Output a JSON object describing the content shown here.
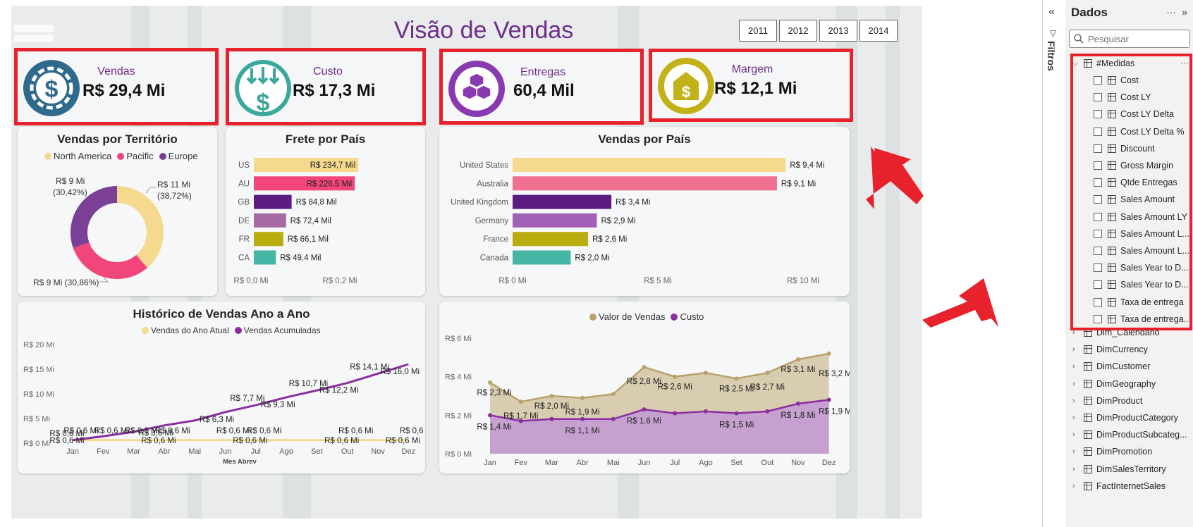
{
  "report": {
    "title": "Visão de Vendas",
    "year_buttons": [
      "2011",
      "2012",
      "2013",
      "2014"
    ]
  },
  "kpis": [
    {
      "label": "Vendas",
      "value": "R$ 29,4 Mi",
      "icon": "dollar-gear-icon",
      "color": "#2e6a8e"
    },
    {
      "label": "Custo",
      "value": "R$ 17,3 Mi",
      "icon": "dollar-arrows-icon",
      "color": "#3aa89b"
    },
    {
      "label": "Entregas",
      "value": "60,4 Mil",
      "icon": "boxes-icon",
      "color": "#8a3ab0"
    },
    {
      "label": "Margem",
      "value": "R$ 12,1 Mi",
      "icon": "dollar-house-icon",
      "color": "#c2b117"
    }
  ],
  "colors": {
    "accent": "#6d2e8c",
    "highlight": "#e8222c"
  },
  "chart_data": [
    {
      "type": "pie",
      "title": "Vendas por Território",
      "categories": [
        "North America",
        "Pacific",
        "Europe"
      ],
      "values": [
        38.72,
        30.86,
        30.42
      ],
      "colors": [
        "#f5d98e",
        "#f0467a",
        "#7b3f98"
      ],
      "data_labels": [
        "R$ 11 Mi",
        "(38,72%)",
        "R$ 9 Mi (30,86%)",
        "R$ 9 Mi",
        "(30,42%)"
      ],
      "legend": "top"
    },
    {
      "type": "bar",
      "orientation": "horizontal",
      "title": "Frete por País",
      "categories": [
        "US",
        "AU",
        "GB",
        "DE",
        "FR",
        "CA"
      ],
      "values": [
        234.7,
        226.5,
        84.8,
        72.4,
        66.1,
        49.4
      ],
      "data_labels": [
        "R$ 234,7 Mil",
        "R$ 226,5 Mil",
        "R$ 84,8 Mil",
        "R$ 72,4 Mil",
        "R$ 66,1 Mil",
        "R$ 49,4 Mil"
      ],
      "colors": [
        "#f5d98e",
        "#f0467a",
        "#5c1b80",
        "#a56aa3",
        "#b9ad0f",
        "#45b5a5"
      ],
      "xlim": [
        0,
        250
      ],
      "xticks": [
        "R$ 0,0 Mi",
        "R$ 0,2 Mi"
      ]
    },
    {
      "type": "bar",
      "orientation": "horizontal",
      "title": "Vendas por País",
      "categories": [
        "United States",
        "Australia",
        "United Kingdom",
        "Germany",
        "France",
        "Canada"
      ],
      "values": [
        9.4,
        9.1,
        3.4,
        2.9,
        2.6,
        2.0
      ],
      "data_labels": [
        "R$ 9,4 Mi",
        "R$ 9,1 Mi",
        "R$ 3,4 Mi",
        "R$ 2,9 Mi",
        "R$ 2,6 Mi",
        "R$ 2,0 Mi"
      ],
      "colors": [
        "#f5d98e",
        "#f0708f",
        "#5c1b80",
        "#a260b8",
        "#b9ad0f",
        "#45b5a5"
      ],
      "xlim": [
        0,
        10
      ],
      "xticks": [
        "R$ 0 Mi",
        "R$ 5 Mi",
        "R$ 10 Mi"
      ]
    },
    {
      "type": "line",
      "title": "Histórico de Vendas Ano a Ano",
      "xlabel": "Mes Abrev",
      "categories": [
        "Jan",
        "Fev",
        "Mar",
        "Abr",
        "Mai",
        "Jun",
        "Jul",
        "Ago",
        "Set",
        "Out",
        "Nov",
        "Dez"
      ],
      "series": [
        {
          "name": "Vendas do Ano Atual",
          "color": "#f5d98e",
          "values": [
            0.6,
            0.6,
            0.6,
            0.6,
            0.6,
            0.6,
            0.6,
            0.6,
            0.6,
            0.6,
            0.6,
            0.6
          ]
        },
        {
          "name": "Vendas Acumuladas",
          "color": "#8a2ea0",
          "values": [
            0.6,
            1.4,
            2.3,
            3.6,
            4.6,
            6.3,
            7.7,
            9.3,
            10.7,
            12.2,
            14.1,
            16.0
          ]
        }
      ],
      "labels_cum": [
        "R$ 0,6 Mi",
        "",
        "",
        "R$ 3,6 Mi",
        "",
        "R$ 6,3 Mi",
        "R$ 7,7 Mi",
        "R$ 9,3 Mi",
        "R$ 10,7 Mi",
        "R$ 12,2 Mi",
        "R$ 14,1 Mi",
        "R$ 16,0 Mi"
      ],
      "labels_cur": [
        "R$ 0,6 Mi",
        "R$ 0,6 Mi",
        "R$ 0,6 Mi",
        "R$ 0,6 Mi",
        "",
        "R$ 0,6 Mi",
        "R$ 0,6 Mi",
        "",
        "",
        "R$ 0,6 Mi",
        "",
        "R$ 0,6 Mi"
      ],
      "labels_cur2": [
        "R$ 0,6 Mi",
        "",
        "",
        "R$ 0,6 Mi",
        "",
        "",
        "R$ 0,6 Mi",
        "",
        "",
        "R$ 0,6 Mi",
        "",
        "R$ 0,6 Mi"
      ],
      "ylim": [
        0,
        20
      ],
      "yticks": [
        "R$ 0 Mi",
        "R$ 5 Mi",
        "R$ 10 Mi",
        "R$ 15 Mi",
        "R$ 20 Mi"
      ],
      "legend": "top"
    },
    {
      "type": "area",
      "categories": [
        "Jan",
        "Fev",
        "Mar",
        "Abr",
        "Mai",
        "Jun",
        "Jul",
        "Ago",
        "Set",
        "Out",
        "Nov",
        "Dez"
      ],
      "series": [
        {
          "name": "Valor de Vendas",
          "color": "#b9a26a",
          "values": [
            3.7,
            2.7,
            3.0,
            2.9,
            3.1,
            4.5,
            4.0,
            4.2,
            3.9,
            4.2,
            4.9,
            5.2
          ]
        },
        {
          "name": "Custo",
          "color": "#8a2ea0",
          "values": [
            2.0,
            1.7,
            1.8,
            1.8,
            1.8,
            2.3,
            2.1,
            2.2,
            2.1,
            2.2,
            2.6,
            2.8
          ]
        }
      ],
      "labels_sales": [
        "R$ 2,3 Mi",
        "R$ 1,7 Mi",
        "R$ 2,0 Mi",
        "R$ 1,9 Mi",
        "",
        "R$ 2,8 Mi",
        "R$ 2,6 Mi",
        "",
        "R$ 2,5 Mi",
        "R$ 2,7 Mi",
        "R$ 3,1 Mi",
        "R$ 3,2 Mi"
      ],
      "labels_cost": [
        "R$ 1,4 Mi",
        "",
        "",
        "R$ 1,1 Mi",
        "",
        "R$ 1,6 Mi",
        "",
        "",
        "R$ 1,5 Mi",
        "",
        "R$ 1,8 Mi",
        "R$ 1,9 Mi"
      ],
      "ylim": [
        0,
        6
      ],
      "yticks": [
        "R$ 0 Mi",
        "R$ 2 Mi",
        "R$ 4 Mi",
        "R$ 6 Mi"
      ],
      "legend": "top"
    }
  ],
  "filters": {
    "label": "Filtros"
  },
  "data_pane": {
    "title": "Dados",
    "search_placeholder": "Pesquisar",
    "measures_table": "#Medidas",
    "measures": [
      "Cost",
      "Cost LY",
      "Cost LY Delta",
      "Cost LY Delta %",
      "Discount",
      "Gross Margin",
      "Qtde Entregas",
      "Sales Amount",
      "Sales Amount LY",
      "Sales Amount L...",
      "Sales Amount L...",
      "Sales Year to D...",
      "Sales Year to D...",
      "Taxa de entrega",
      "Taxa de entrega..."
    ],
    "tables": [
      "Dim_Calendario",
      "DimCurrency",
      "DimCustomer",
      "DimGeography",
      "DimProduct",
      "DimProductCategory",
      "DimProductSubcateg...",
      "DimPromotion",
      "DimSalesTerritory",
      "FactInternetSales"
    ]
  }
}
